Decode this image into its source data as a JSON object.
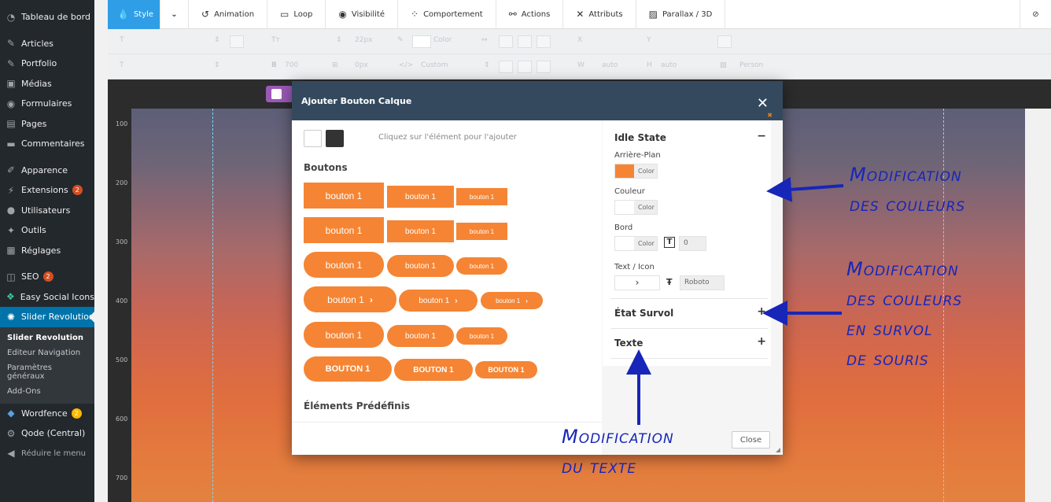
{
  "sidebar": {
    "items": [
      {
        "label": "Tableau de bord",
        "icon": "dashboard-icon"
      },
      {
        "label": "Articles",
        "icon": "pin-icon"
      },
      {
        "label": "Portfolio",
        "icon": "pin-icon"
      },
      {
        "label": "Médias",
        "icon": "media-icon"
      },
      {
        "label": "Formulaires",
        "icon": "forms-icon"
      },
      {
        "label": "Pages",
        "icon": "pages-icon"
      },
      {
        "label": "Commentaires",
        "icon": "comments-icon"
      },
      {
        "label": "Apparence",
        "icon": "brush-icon"
      },
      {
        "label": "Extensions",
        "icon": "plugin-icon",
        "badge": "2"
      },
      {
        "label": "Utilisateurs",
        "icon": "user-icon"
      },
      {
        "label": "Outils",
        "icon": "wrench-icon"
      },
      {
        "label": "Réglages",
        "icon": "settings-icon"
      },
      {
        "label": "SEO",
        "icon": "seo-icon",
        "badge": "2"
      },
      {
        "label": "Easy Social Icons",
        "icon": "share-icon"
      },
      {
        "label": "Slider Revolution",
        "icon": "slider-icon"
      }
    ],
    "submenu": [
      "Slider Revolution",
      "Editeur Navigation",
      "Paramètres généraux",
      "Add-Ons"
    ],
    "after": [
      {
        "label": "Wordfence",
        "icon": "wordfence-icon",
        "badge": "2"
      },
      {
        "label": "Qode (Central)",
        "icon": "gear-icon"
      },
      {
        "label": "Réduire le menu",
        "icon": "collapse-icon"
      }
    ]
  },
  "toolbar": {
    "tabs": [
      "Style",
      "Animation",
      "Loop",
      "Visibilité",
      "Comportement",
      "Actions",
      "Attributs",
      "Parallax / 3D"
    ]
  },
  "propbar": {
    "color1": "Color",
    "size1": "22px",
    "weight": "700",
    "lineh": "0px",
    "custom": "Custom",
    "auto1": "auto",
    "auto2": "auto",
    "person": "Person"
  },
  "ruler": [
    "100",
    "200",
    "300",
    "400",
    "500",
    "600",
    "700"
  ],
  "modal": {
    "title": "Ajouter Bouton Calque",
    "hint": "Cliquez sur l'élément pour l'ajouter",
    "buttons_title": "Boutons",
    "btn_label": "bouton 1",
    "btn_label_upper": "BOUTON 1",
    "predef_title": "Éléments Prédéfinis",
    "close_label": "Close"
  },
  "settings": {
    "idle_state": "Idle State",
    "bg_label": "Arrière-Plan",
    "color_label": "Couleur",
    "border_label": "Bord",
    "text_icon_label": "Text / Icon",
    "color_text": "Color",
    "border_width": "0",
    "font": "Roboto",
    "hover_state": "État Survol",
    "text_section": "Texte"
  },
  "colors": {
    "accent": "#f58534",
    "header": "#34495e",
    "annotation": "#1726b8",
    "style_tab": "#2f9ee6"
  },
  "annotations": {
    "a1_l1": "Modification",
    "a1_l2": "des couleurs",
    "a2_l1": "Modification",
    "a2_l2": "des couleurs",
    "a2_l3": "en survol",
    "a2_l4": "de souris",
    "a3_l1": "Modification",
    "a3_l2": "du texte"
  }
}
